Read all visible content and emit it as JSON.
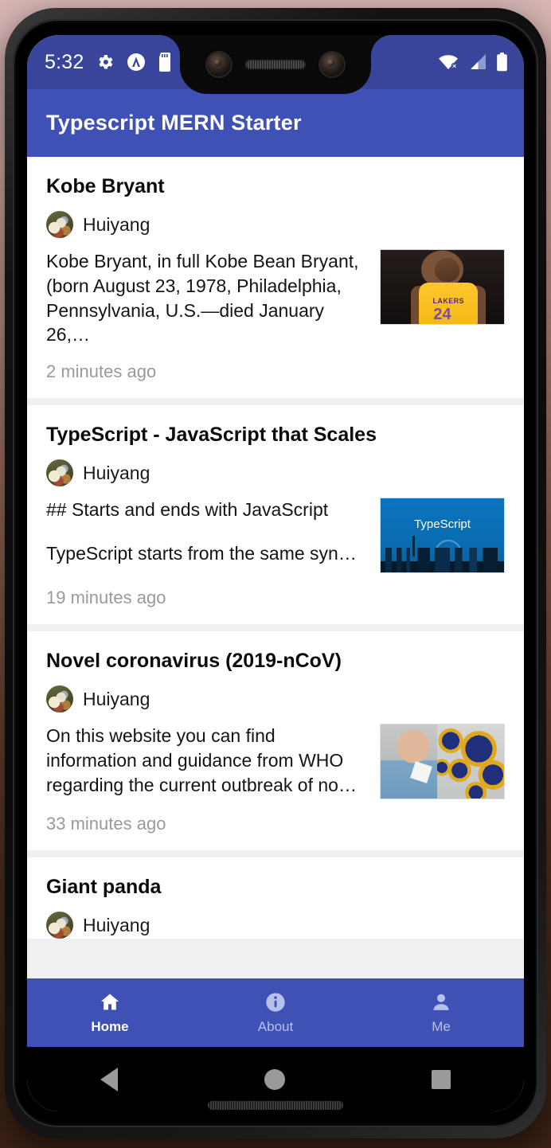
{
  "statusbar": {
    "time": "5:32",
    "icons_left": [
      "gear-icon",
      "expo-circle-a-icon",
      "sd-card-icon"
    ],
    "icons_right": [
      "wifi-off-icon",
      "cell-signal-icon",
      "battery-full-icon"
    ]
  },
  "appbar": {
    "title": "Typescript MERN Starter"
  },
  "articles": [
    {
      "title": "Kobe Bryant",
      "author": "Huiyang",
      "paragraphs": [
        "Kobe Bryant, in full Kobe Bean Bryant, (born August 23, 1978, Philadelphia, Pennsylvania, U.S.—died January 26,…"
      ],
      "timestamp": "2 minutes ago",
      "thumbnail": "kobe-bryant-lakers-photo"
    },
    {
      "title": "TypeScript - JavaScript that Scales",
      "author": "Huiyang",
      "paragraphs": [
        "## Starts and ends with JavaScript",
        "TypeScript starts from the same syn…"
      ],
      "timestamp": "19 minutes ago",
      "thumbnail": "typescript-banner-image",
      "thumbnail_text": "TypeScript"
    },
    {
      "title": "Novel coronavirus (2019-nCoV)",
      "author": "Huiyang",
      "paragraphs": [
        "On this website you can find information and guidance from WHO regarding the current outbreak of no…"
      ],
      "timestamp": "33 minutes ago",
      "thumbnail": "coronavirus-photo"
    },
    {
      "title": "Giant panda",
      "author": "Huiyang",
      "paragraphs": [],
      "timestamp": "",
      "thumbnail": ""
    }
  ],
  "bottomnav": {
    "items": [
      {
        "label": "Home",
        "icon": "home-icon",
        "active": true
      },
      {
        "label": "About",
        "icon": "info-icon",
        "active": false
      },
      {
        "label": "Me",
        "icon": "person-icon",
        "active": false
      }
    ]
  },
  "sysnav": {
    "back": "back-triangle-icon",
    "home": "home-circle-icon",
    "recents": "recents-square-icon"
  },
  "colors": {
    "appbar": "#3f51b5",
    "statusbar": "#39459b",
    "nav_active": "#ffffff",
    "nav_inactive": "#b7c0ec",
    "card_bg": "#ffffff",
    "page_bg": "#f0f0f0",
    "timestamp": "#9a9a9a"
  }
}
